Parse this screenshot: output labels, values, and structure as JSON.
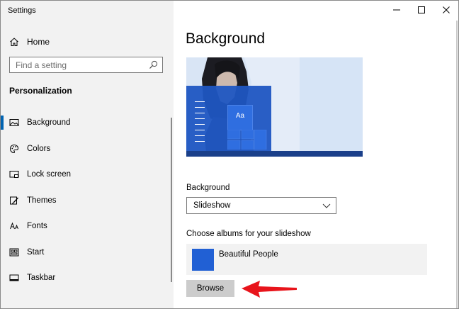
{
  "window": {
    "title": "Settings"
  },
  "sidebar": {
    "home_label": "Home",
    "search_placeholder": "Find a setting",
    "section_title": "Personalization",
    "items": [
      {
        "label": "Background",
        "icon": "picture-icon",
        "active": true
      },
      {
        "label": "Colors",
        "icon": "palette-icon",
        "active": false
      },
      {
        "label": "Lock screen",
        "icon": "lock-screen-icon",
        "active": false
      },
      {
        "label": "Themes",
        "icon": "brush-icon",
        "active": false
      },
      {
        "label": "Fonts",
        "icon": "font-icon",
        "active": false
      },
      {
        "label": "Start",
        "icon": "start-icon",
        "active": false
      },
      {
        "label": "Taskbar",
        "icon": "taskbar-icon",
        "active": false
      }
    ]
  },
  "main": {
    "title": "Background",
    "preview": {
      "sample_text": "Aa"
    },
    "background_label": "Background",
    "background_value": "Slideshow",
    "albums_label": "Choose albums for your slideshow",
    "album_name": "Beautiful People",
    "browse_label": "Browse"
  },
  "colors": {
    "accent": "#0063b1",
    "tile_blue": "#2160d4",
    "arrow_red": "#e8141b"
  }
}
